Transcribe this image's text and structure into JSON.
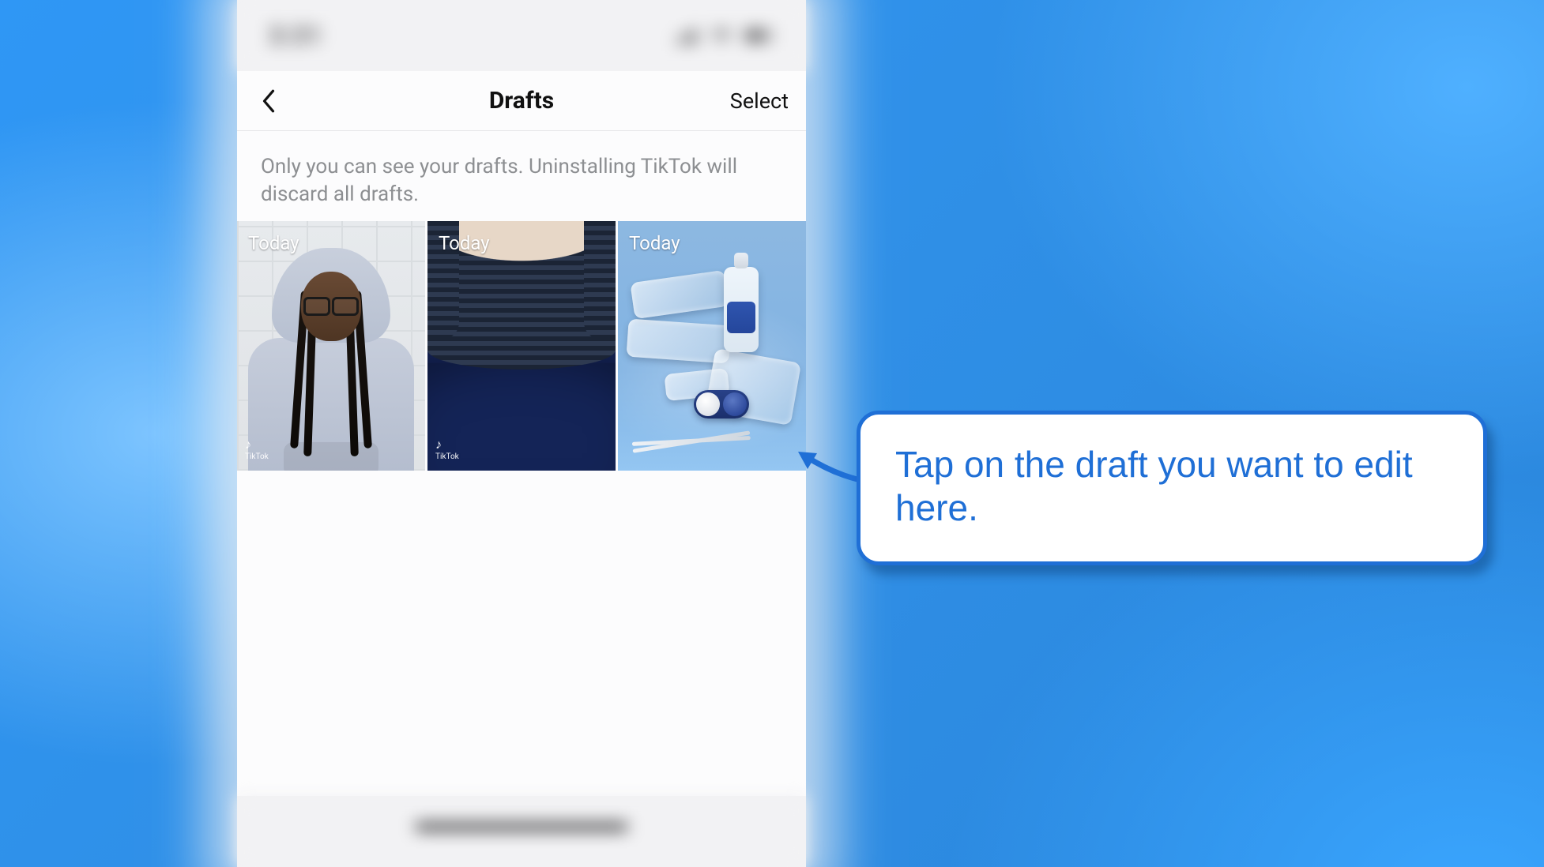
{
  "statusbar": {
    "time": "3:31"
  },
  "nav": {
    "title": "Drafts",
    "select_label": "Select"
  },
  "info_text": "Only you can see your drafts. Uninstalling TikTok will discard all drafts.",
  "drafts": [
    {
      "day_label": "Today",
      "watermark_app": "TikTok"
    },
    {
      "day_label": "Today",
      "watermark_app": "TikTok"
    },
    {
      "day_label": "Today"
    }
  ],
  "callout": {
    "text": "Tap on the draft you want to edit here."
  }
}
